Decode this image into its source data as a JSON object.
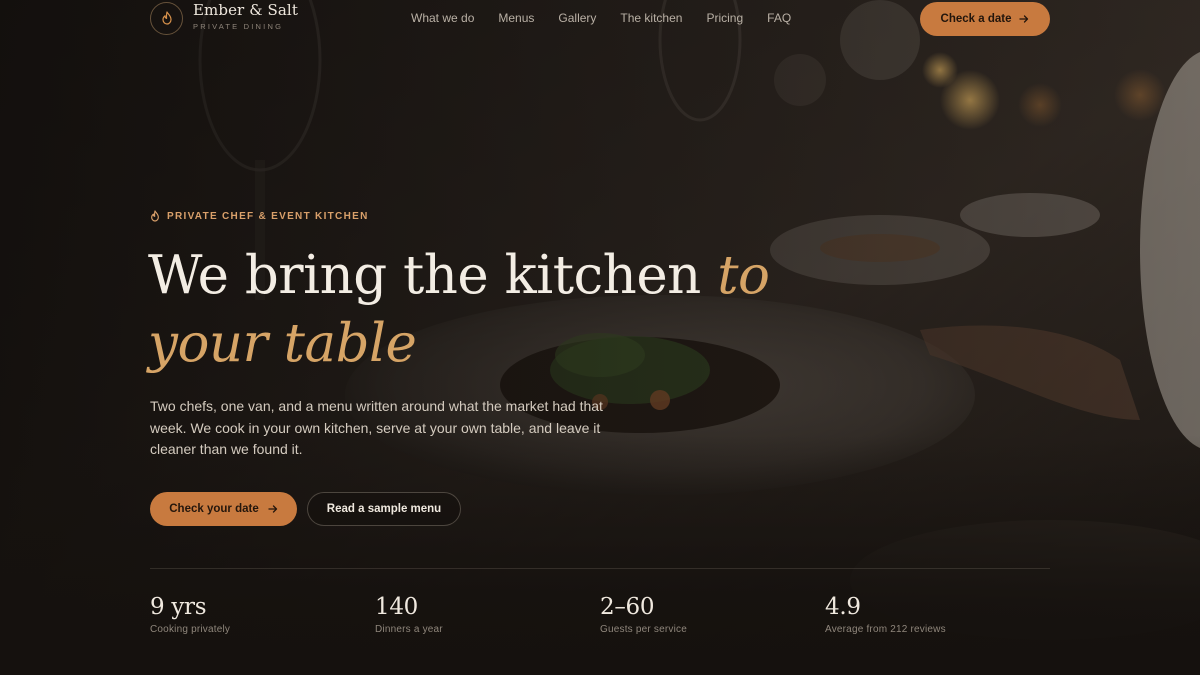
{
  "brand": {
    "name": "Ember & Salt",
    "tagline": "PRIVATE DINING",
    "logo_icon": "flame-icon"
  },
  "nav": {
    "links": [
      "What we do",
      "Menus",
      "Gallery",
      "The kitchen",
      "Pricing",
      "FAQ"
    ],
    "cta_label": "Check a date",
    "cta_icon": "arrow-right-icon"
  },
  "hero": {
    "eyebrow": "PRIVATE CHEF & EVENT KITCHEN",
    "eyebrow_icon": "flame-icon",
    "headline_main": "We bring the kitchen",
    "headline_accent_1": "to",
    "headline_accent_2": "your table",
    "lede": "Two chefs, one van, and a menu written around what the market had that week. We cook in your own kitchen, serve at your own table, and leave it cleaner than we found it.",
    "primary_label": "Check your date",
    "secondary_label": "Read a sample menu"
  },
  "stats": [
    {
      "value": "9 yrs",
      "label": "Cooking privately"
    },
    {
      "value": "140",
      "label": "Dinners a year"
    },
    {
      "value": "2–60",
      "label": "Guests per service"
    },
    {
      "value": "4.9",
      "label": "Average from 212 reviews"
    }
  ],
  "colors": {
    "accent": "#c87a3f",
    "accent_text": "#d6a466",
    "background": "#15110e"
  }
}
